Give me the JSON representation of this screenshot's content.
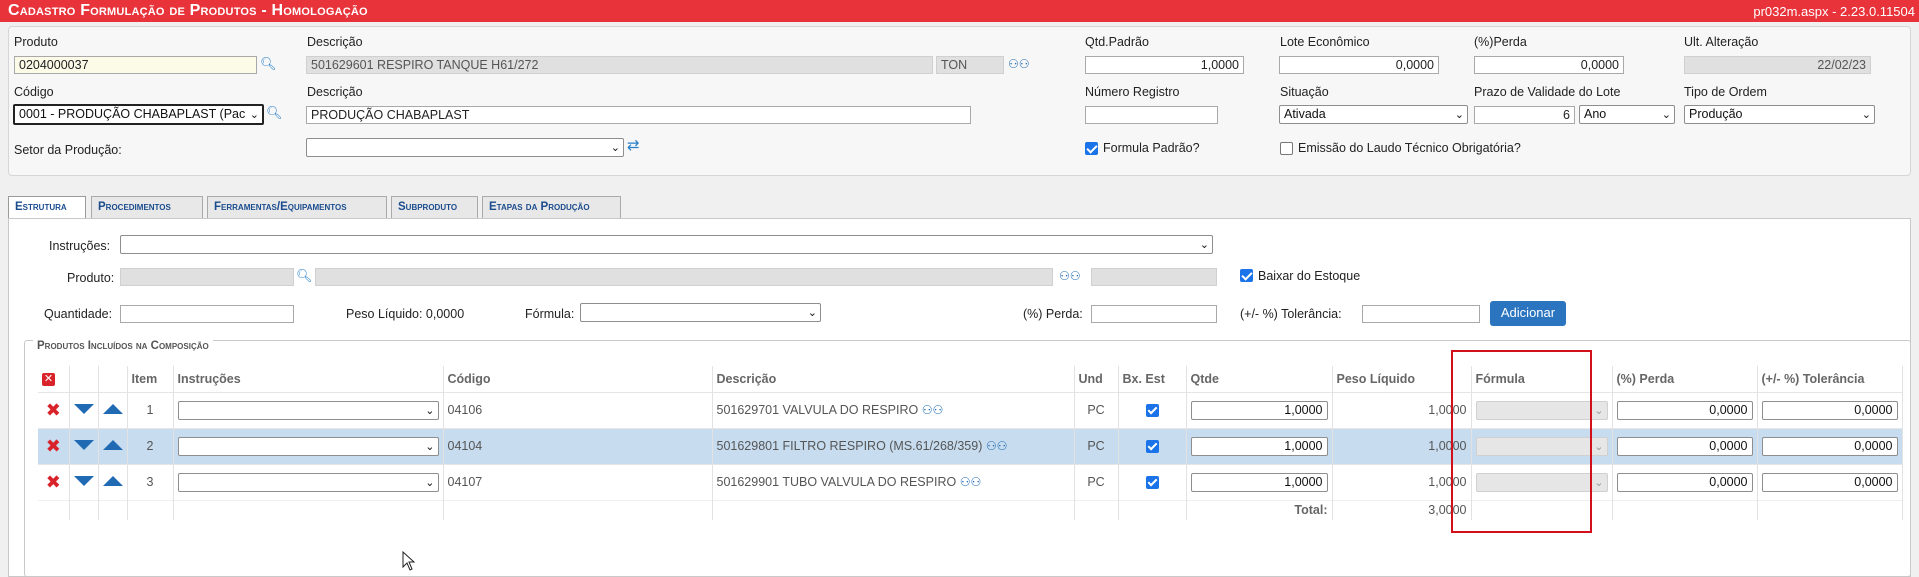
{
  "header": {
    "title": "Cadastro Formulação de Produtos  - Homologação",
    "version": "pr032m.aspx - 2.23.0.11504"
  },
  "form": {
    "produto_label": "Produto",
    "produto_value": "0204000037",
    "descricao_label": "Descrição",
    "descricao_value": "501629601 RESPIRO TANQUE H61/272",
    "unidade_value": "TON",
    "qtd_padrao_label": "Qtd.Padrão",
    "qtd_padrao_value": "1,0000",
    "lote_label": "Lote Econômico",
    "lote_value": "0,0000",
    "perda_label": "(%)Perda",
    "perda_value": "0,0000",
    "ult_alt_label": "Ult. Alteração",
    "ult_alt_value": "22/02/23",
    "codigo_label": "Código",
    "codigo_value": "0001 - PRODUÇÃO CHABAPLAST (Pac",
    "descricao2_label": "Descrição",
    "descricao2_value": "PRODUÇÃO CHABAPLAST",
    "num_registro_label": "Número Registro",
    "num_registro_value": "",
    "situacao_label": "Situação",
    "situacao_value": "Ativada",
    "prazo_label": "Prazo de Validade do Lote",
    "prazo_value": "6",
    "prazo_unit": "Ano",
    "tipo_ordem_label": "Tipo de Ordem",
    "tipo_ordem_value": "Produção",
    "setor_label": "Setor da Produção:",
    "setor_value": "",
    "formula_padrao_label": "Formula Padrão?",
    "formula_padrao_checked": true,
    "laudo_label": "Emissão do Laudo Técnico Obrigatória?",
    "laudo_checked": false
  },
  "tabs": [
    {
      "label": "Estrutura",
      "active": true
    },
    {
      "label": "Procedimentos",
      "active": false
    },
    {
      "label": "Ferramentas/Equipamentos",
      "active": false
    },
    {
      "label": "Subproduto",
      "active": false
    },
    {
      "label": "Etapas da Produção",
      "active": false
    }
  ],
  "estrutura": {
    "instrucoes_label": "Instruções:",
    "produto_label": "Produto:",
    "baixar_label": "Baixar do Estoque",
    "quantidade_label": "Quantidade:",
    "peso_liquido_label": "Peso Líquido: 0,0000",
    "formula_label": "Fórmula:",
    "perda_label": "(%) Perda:",
    "tolerancia_label": "(+/- %) Tolerância:",
    "adicionar_label": "Adicionar"
  },
  "composicao": {
    "legend": "Produtos Incluídos na Composição",
    "columns": {
      "item": "Item",
      "instrucoes": "Instruções",
      "codigo": "Código",
      "descricao": "Descrição",
      "und": "Und",
      "bx_est": "Bx. Est",
      "qtde": "Qtde",
      "peso_liquido": "Peso Líquido",
      "formula": "Fórmula",
      "perda": "(%) Perda",
      "tolerancia": "(+/- %) Tolerância"
    },
    "rows": [
      {
        "item": "1",
        "codigo": "04106",
        "descricao": "501629701 VALVULA DO RESPIRO",
        "und": "PC",
        "qtde": "1,0000",
        "peso": "1,0000",
        "perda": "0,0000",
        "tolerancia": "0,0000"
      },
      {
        "item": "2",
        "codigo": "04104",
        "descricao": "501629801 FILTRO RESPIRO (MS.61/268/359)",
        "und": "PC",
        "qtde": "1,0000",
        "peso": "1,0000",
        "perda": "0,0000",
        "tolerancia": "0,0000"
      },
      {
        "item": "3",
        "codigo": "04107",
        "descricao": "501629901 TUBO VALVULA DO RESPIRO",
        "und": "PC",
        "qtde": "1,0000",
        "peso": "1,0000",
        "perda": "0,0000",
        "tolerancia": "0,0000"
      }
    ],
    "total_label": "Total:",
    "total_value": "3,0000"
  },
  "colors": {
    "titlebar": "#e8333b",
    "accent": "#2a74c0",
    "row_highlight": "#c7dcef",
    "annotation": "#d40f1c"
  }
}
